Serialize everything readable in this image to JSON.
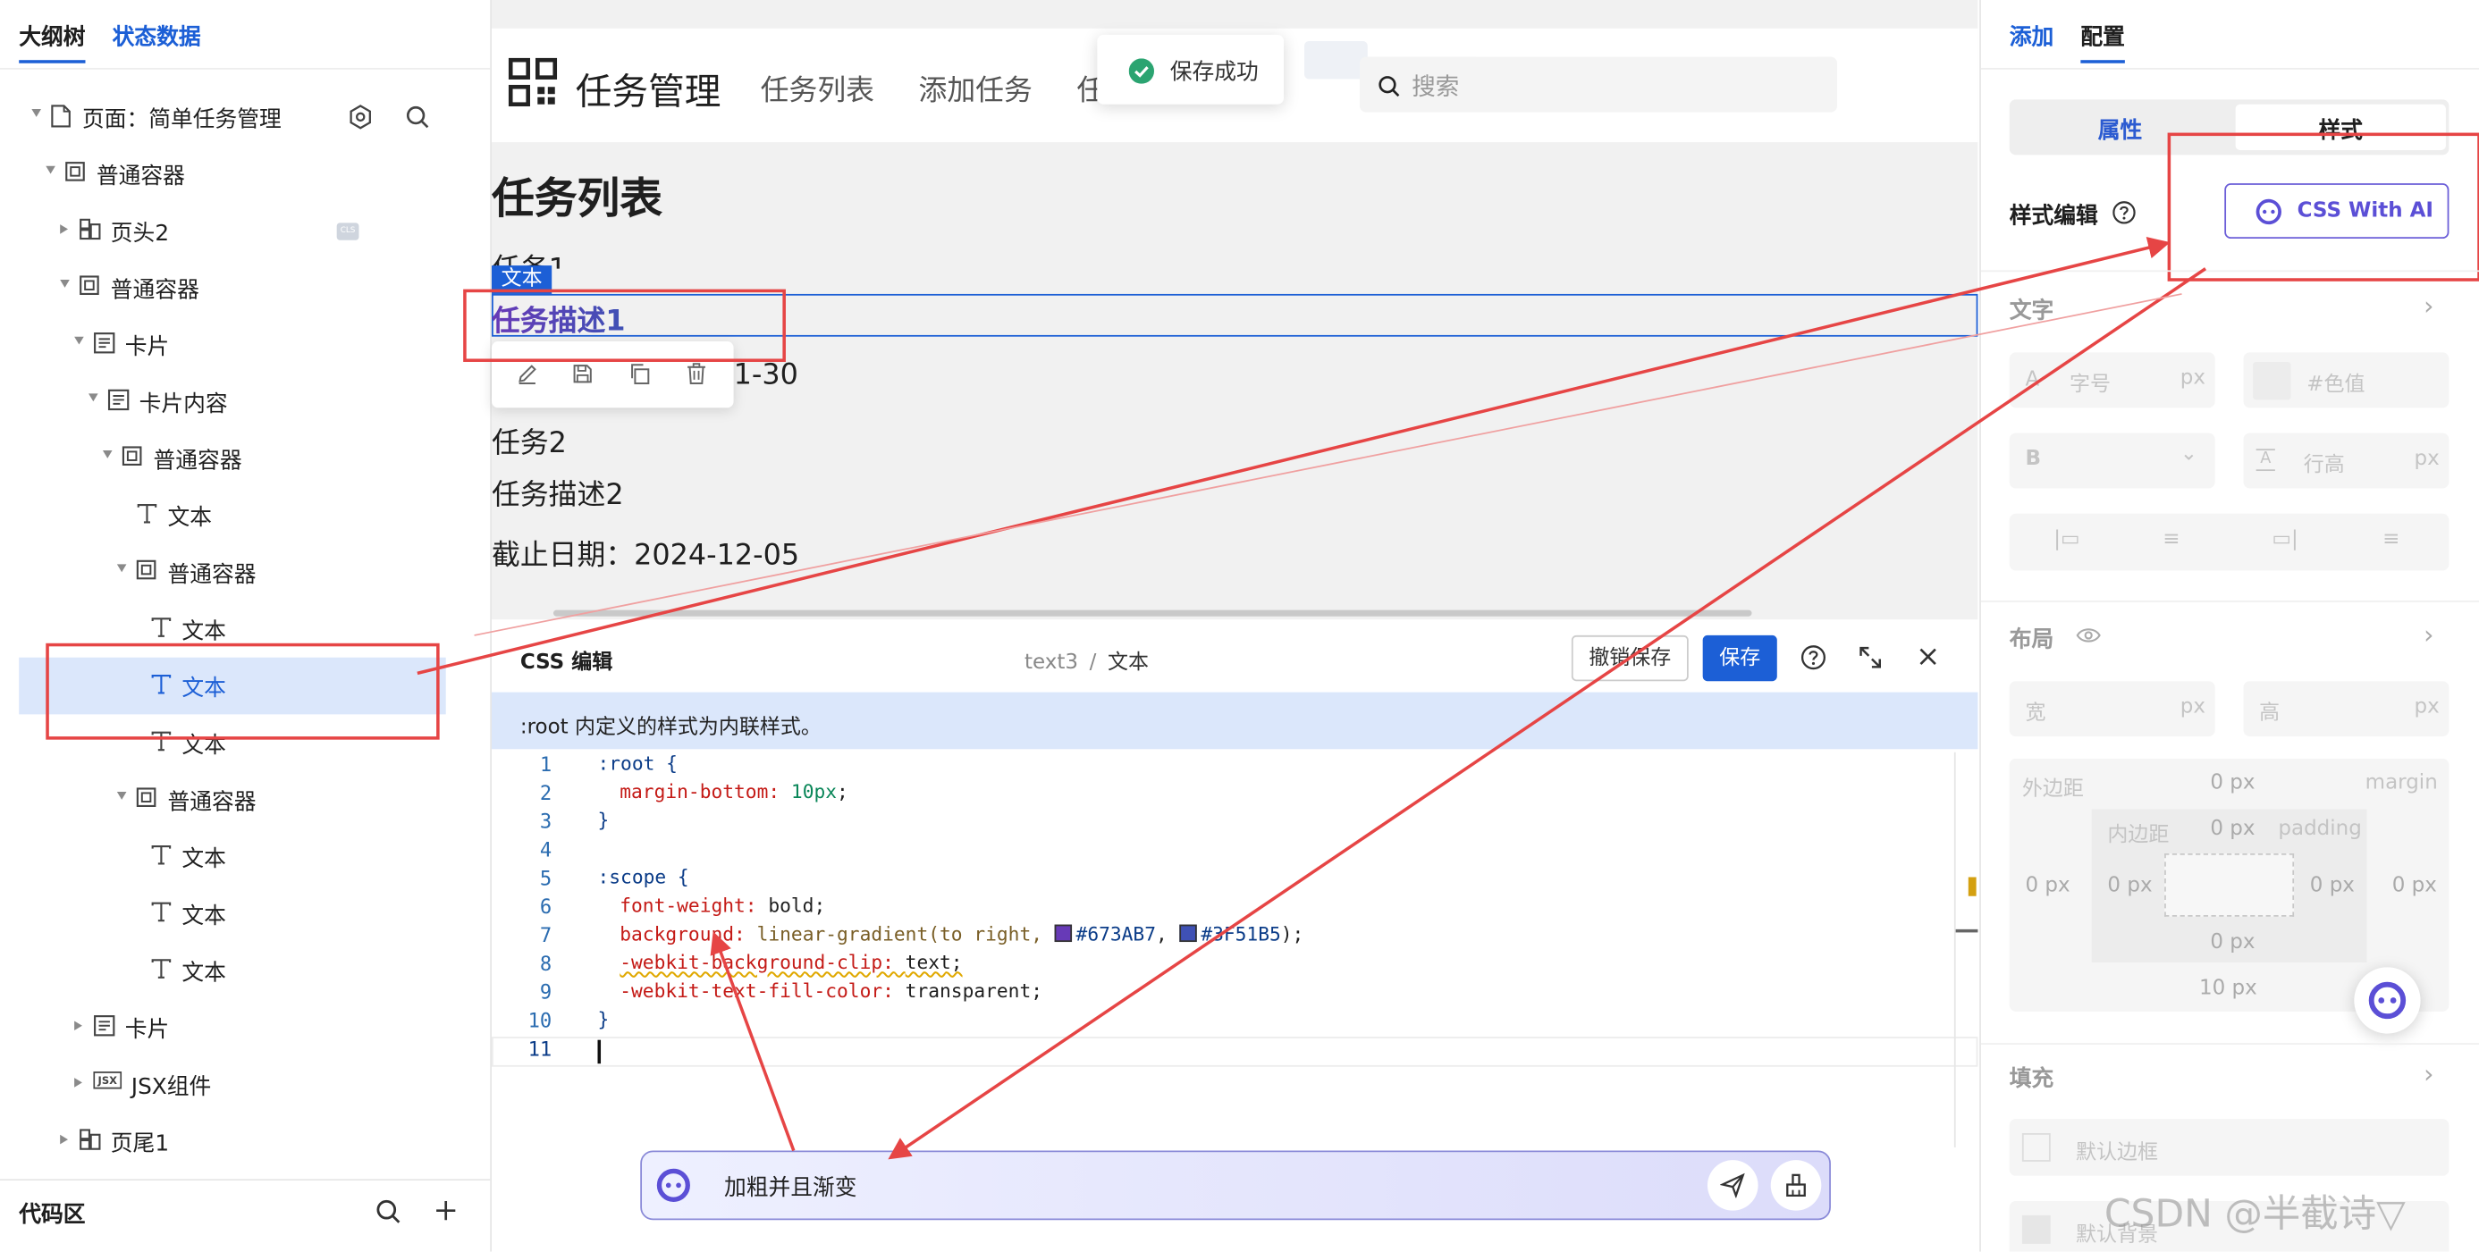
{
  "left_panel": {
    "tabs": [
      "大纲树",
      "状态数据"
    ],
    "tree": [
      {
        "label": "页面：简单任务管理",
        "depth": 0,
        "icon": "page",
        "expanded": true
      },
      {
        "label": "普通容器",
        "depth": 1,
        "icon": "container",
        "expanded": true
      },
      {
        "label": "页头2",
        "depth": 2,
        "icon": "block",
        "expanded": false,
        "badge": "CLS"
      },
      {
        "label": "普通容器",
        "depth": 2,
        "icon": "container",
        "expanded": true
      },
      {
        "label": "卡片",
        "depth": 3,
        "icon": "card",
        "expanded": true
      },
      {
        "label": "卡片内容",
        "depth": 4,
        "icon": "card",
        "expanded": true
      },
      {
        "label": "普通容器",
        "depth": 5,
        "icon": "container",
        "expanded": true
      },
      {
        "label": "文本",
        "depth": 6,
        "icon": "text"
      },
      {
        "label": "普通容器",
        "depth": 6,
        "icon": "container",
        "expanded": true
      },
      {
        "label": "文本",
        "depth": 7,
        "icon": "text"
      },
      {
        "label": "文本",
        "depth": 7,
        "icon": "text",
        "selected": true
      },
      {
        "label": "文本",
        "depth": 7,
        "icon": "text"
      },
      {
        "label": "普通容器",
        "depth": 6,
        "icon": "container",
        "expanded": true
      },
      {
        "label": "文本",
        "depth": 7,
        "icon": "text"
      },
      {
        "label": "文本",
        "depth": 7,
        "icon": "text"
      },
      {
        "label": "文本",
        "depth": 7,
        "icon": "text"
      },
      {
        "label": "卡片",
        "depth": 3,
        "icon": "card",
        "expanded": false
      },
      {
        "label": "JSX组件",
        "depth": 3,
        "icon": "jsx",
        "expanded": false
      },
      {
        "label": "页尾1",
        "depth": 2,
        "icon": "block",
        "expanded": false
      }
    ],
    "code_area_label": "代码区"
  },
  "canvas": {
    "app_title": "任务管理",
    "nav": [
      "任务列表",
      "添加任务",
      "任务状态"
    ],
    "toast": "保存成功",
    "search_placeholder": "搜索",
    "section_title": "任务列表",
    "task1_name": "任务1",
    "selected_tag": "文本",
    "task1_desc": "任务描述1",
    "task1_date_tail": "1-30",
    "task2_name": "任务2",
    "task2_desc": "任务描述2",
    "task2_date": "截止日期：2024-12-05"
  },
  "css_editor": {
    "title": "CSS 编辑",
    "path_node": "text3",
    "path_sep": "/",
    "path_label": "文本",
    "revert_label": "撤销保存",
    "save_label": "保存",
    "info": ":root 内定义的样式为内联样式。",
    "line_numbers": [
      "1",
      "2",
      "3",
      "4",
      "5",
      "6",
      "7",
      "8",
      "9",
      "10",
      "11"
    ],
    "code": {
      "l1_sel": ":root {",
      "l2_prop": "margin-bottom: ",
      "l2_val": "10px",
      "l3": "}",
      "l5_sel": ":scope {",
      "l6_prop": "font-weight: ",
      "l6_val": "bold;",
      "l7_prop": "background: ",
      "l7_fn": "linear-gradient(to right, ",
      "l7_c1": "#673AB7",
      "l7_c2": "#3F51B5",
      "l8_prop": "-webkit-background-clip: ",
      "l8_val": "text;",
      "l9_prop": "-webkit-text-fill-color: ",
      "l9_val": "transparent;",
      "l10": "}"
    },
    "ai_prompt": "加粗并且渐变"
  },
  "right_panel": {
    "tabs": [
      "添加",
      "配置"
    ],
    "seg": [
      "属性",
      "样式"
    ],
    "style_edit_label": "样式编辑",
    "css_ai_button": "CSS With AI",
    "sections": {
      "text": "文字",
      "layout": "布局",
      "fill": "填充"
    },
    "text_fields": {
      "font_size": "字号",
      "unit": "px",
      "color": "#色值",
      "weight_prefix": "B",
      "line_height": "行高",
      "a": "A"
    },
    "layout_fields": {
      "w": "宽",
      "h": "高",
      "unit": "px"
    },
    "box": {
      "margin_label": "外边距",
      "margin_en": "margin",
      "padding_label": "内边距",
      "padding_en": "padding",
      "margin_top": "0 px",
      "margin_left": "0 px",
      "margin_right": "0 px",
      "margin_bottom": "10 px",
      "padding_top": "0 px",
      "padding_left": "0 px",
      "padding_right": "0 px",
      "padding_bottom": "0 px"
    },
    "fill": {
      "border": "默认边框",
      "bg": "默认背景"
    },
    "watermark": "CSDN @半截诗▽"
  },
  "colors": {
    "accent": "#1c5fd6",
    "purple": "#673AB7",
    "indigo": "#3F51B5",
    "red_annotation": "#e64545"
  }
}
